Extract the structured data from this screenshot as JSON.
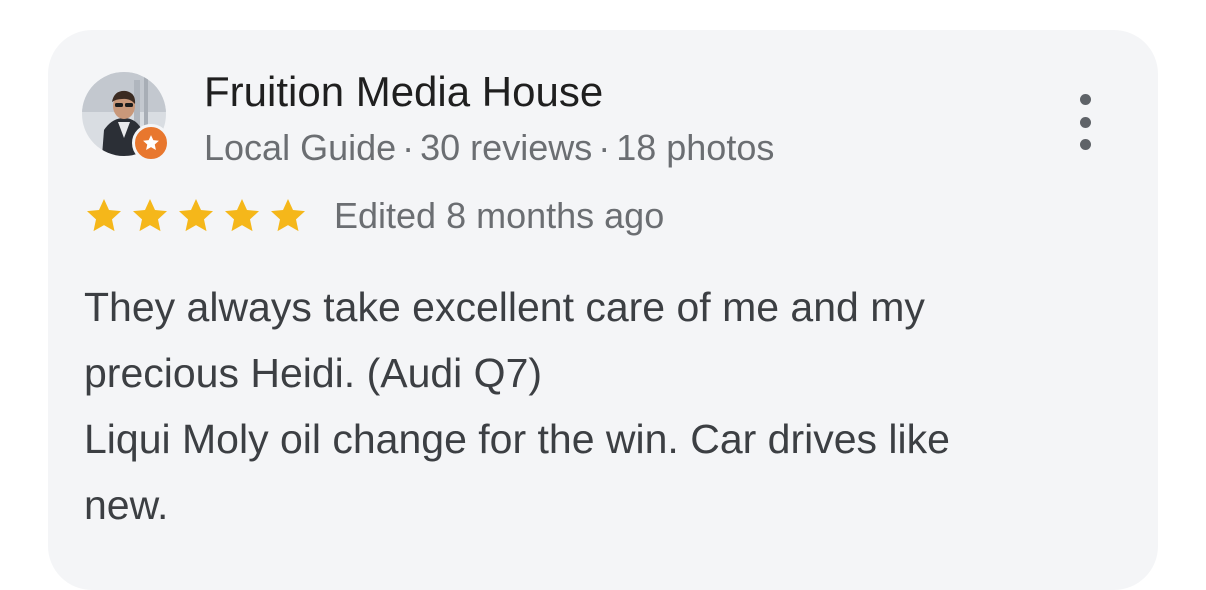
{
  "review": {
    "author": {
      "name": "Fruition Media House",
      "avatar_icon": "person-photo",
      "badge_icon": "local-guide-star-icon",
      "badge_color": "#e8772e",
      "guide_label": "Local Guide",
      "separator": "·",
      "reviews_count": "30 reviews",
      "photos_count": "18 photos"
    },
    "more_icon": "more-vertical-icon",
    "rating": 5,
    "rating_max": 5,
    "star_color": "#f5b71a",
    "edited": "Edited 8 months ago",
    "text_lines": [
      "They always take excellent care of me and my",
      "precious Heidi. (Audi Q7)",
      "Liqui Moly oil change for the win. Car drives like",
      "new."
    ]
  }
}
